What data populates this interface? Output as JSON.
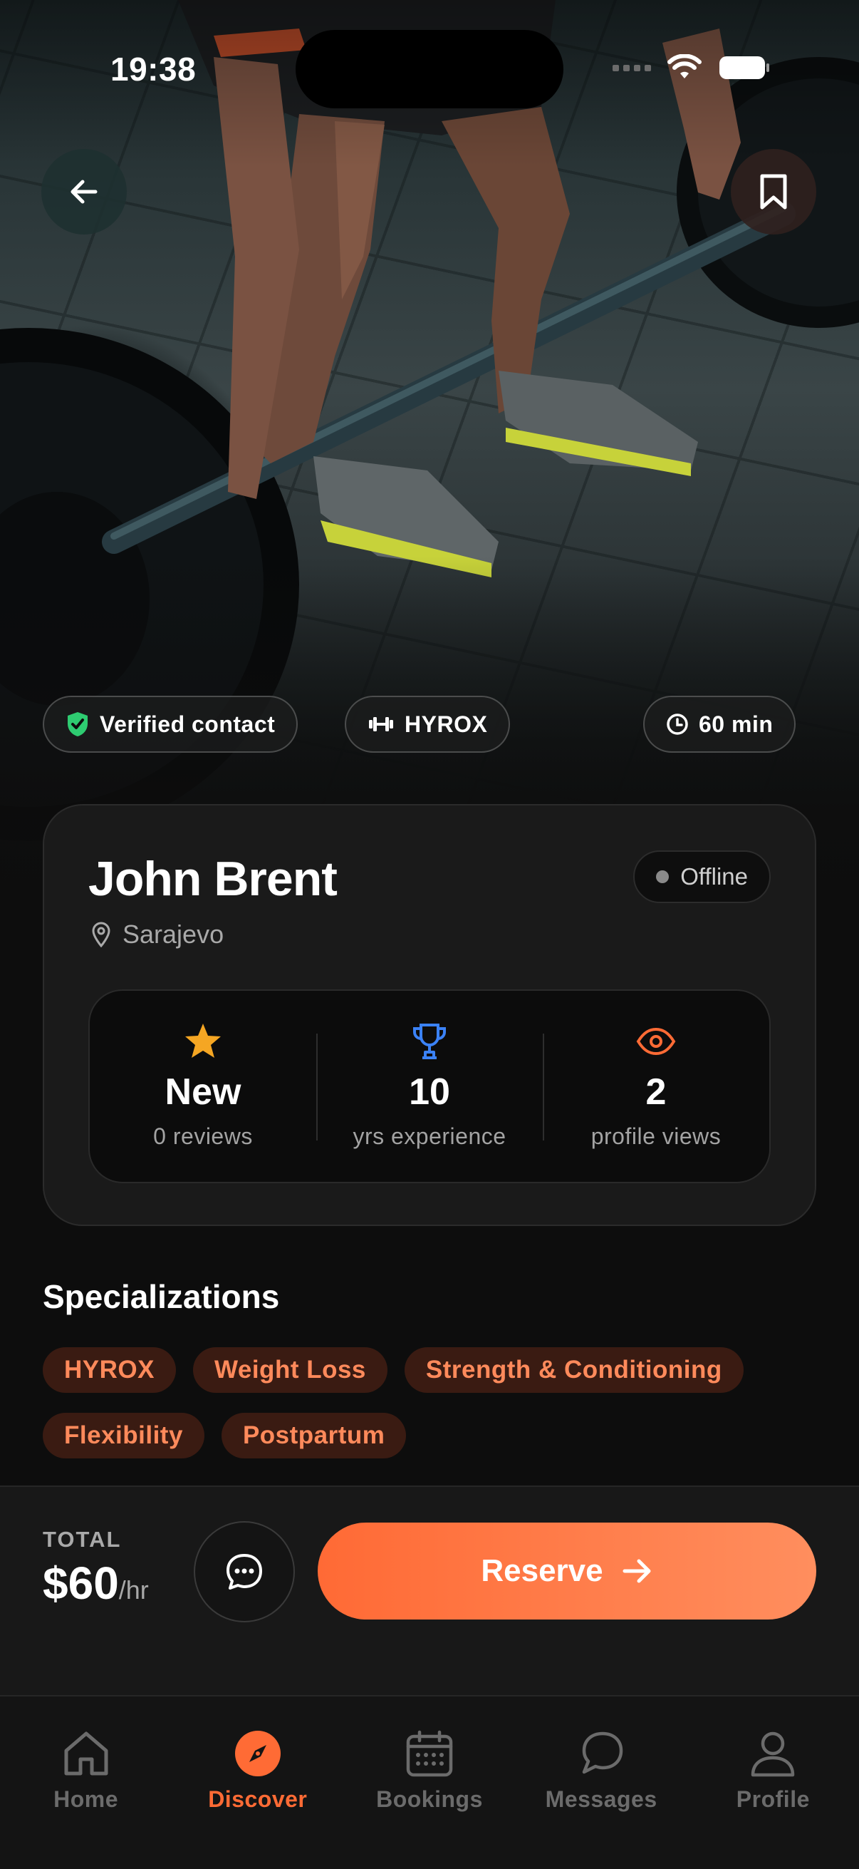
{
  "status_bar": {
    "time": "19:38"
  },
  "hero": {
    "chips": {
      "verified": "Verified contact",
      "category": "HYROX",
      "duration": "60 min"
    }
  },
  "trainer": {
    "name": "John Brent",
    "location": "Sarajevo",
    "status": "Offline",
    "stats": [
      {
        "icon": "star-icon",
        "value": "New",
        "label": "0 reviews"
      },
      {
        "icon": "trophy-icon",
        "value": "10",
        "label": "yrs experience"
      },
      {
        "icon": "eye-icon",
        "value": "2",
        "label": "profile views"
      }
    ]
  },
  "specializations": {
    "title": "Specializations",
    "tags": [
      "HYROX",
      "Weight Loss",
      "Strength & Conditioning",
      "Flexibility",
      "Postpartum"
    ]
  },
  "booking": {
    "total_label": "TOTAL",
    "price": "$60",
    "unit": "/hr",
    "reserve_label": "Reserve"
  },
  "tabs": [
    {
      "label": "Home",
      "icon": "home-icon",
      "active": false
    },
    {
      "label": "Discover",
      "icon": "compass-icon",
      "active": true
    },
    {
      "label": "Bookings",
      "icon": "calendar-icon",
      "active": false
    },
    {
      "label": "Messages",
      "icon": "chat-bubble-icon",
      "active": false
    },
    {
      "label": "Profile",
      "icon": "person-icon",
      "active": false
    }
  ],
  "colors": {
    "accent": "#ff6b35",
    "tag_bg": "#3a1b12",
    "tag_text": "#ff8a5b",
    "verified": "#2ecc71",
    "trophy": "#3b82f6",
    "star": "#f5a623"
  }
}
